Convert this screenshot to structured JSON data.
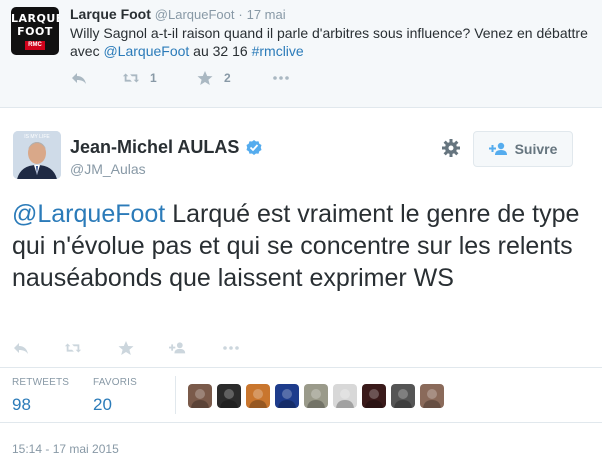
{
  "parent_tweet": {
    "avatar": {
      "line1": "LARQUE",
      "line2": "FOOT",
      "badge": "RMC"
    },
    "name": "Larque Foot",
    "handle": "@LarqueFoot",
    "separator": "·",
    "time": "17 mai",
    "text_before_link": "Willy Sagnol a-t-il raison quand il parle d'arbitres sous influence? Venez en débattre avec ",
    "mention": "@LarqueFoot",
    "text_middle": " au 32 16 ",
    "hashtag": "#rmclive",
    "actions": {
      "reply_icon": "reply-icon",
      "retweet_icon": "retweet-icon",
      "retweet_count": "1",
      "favorite_icon": "star-icon",
      "favorite_count": "2",
      "more_icon": "more-icon"
    }
  },
  "main_tweet": {
    "avatar": {
      "banner": "IS MY LIFE"
    },
    "name": "Jean-Michel AULAS",
    "handle": "@JM_Aulas",
    "verified_icon": "verified-badge-icon",
    "settings_icon": "gear-icon",
    "follow_button": {
      "icon": "add-user-icon",
      "label": "Suivre"
    },
    "mention": "@LarqueFoot",
    "text": " Larqué est vraiment le genre de type qui n'évolue pas et qui se concentre sur les relents nauséabonds que laissent exprimer WS",
    "actions": {
      "reply_icon": "reply-icon",
      "retweet_icon": "retweet-icon",
      "favorite_icon": "star-icon",
      "follow_icon": "add-user-icon",
      "more_icon": "more-icon"
    },
    "stats": {
      "retweets_label": "RETWEETS",
      "retweets_value": "98",
      "favorites_label": "FAVORIS",
      "favorites_value": "20"
    },
    "favoriters": [
      {
        "name": "favoriter-avatar-1",
        "color": "#7a5a4a"
      },
      {
        "name": "favoriter-avatar-2",
        "color": "#2b2b2b"
      },
      {
        "name": "favoriter-avatar-3",
        "color": "#c9762e"
      },
      {
        "name": "favoriter-avatar-4",
        "color": "#1e3c8c"
      },
      {
        "name": "favoriter-avatar-5",
        "color": "#9a9a8a"
      },
      {
        "name": "favoriter-avatar-6",
        "color": "#d8d8d8"
      },
      {
        "name": "favoriter-avatar-7",
        "color": "#3a1a1a"
      },
      {
        "name": "favoriter-avatar-8",
        "color": "#555555"
      },
      {
        "name": "favoriter-avatar-9",
        "color": "#8a6a5a"
      }
    ],
    "timestamp": "15:14 - 17 mai 2015"
  },
  "colors": {
    "link": "#2b7bb9",
    "verified": "#55acee",
    "muted": "#8899a6",
    "icon": "#aab8c2"
  }
}
